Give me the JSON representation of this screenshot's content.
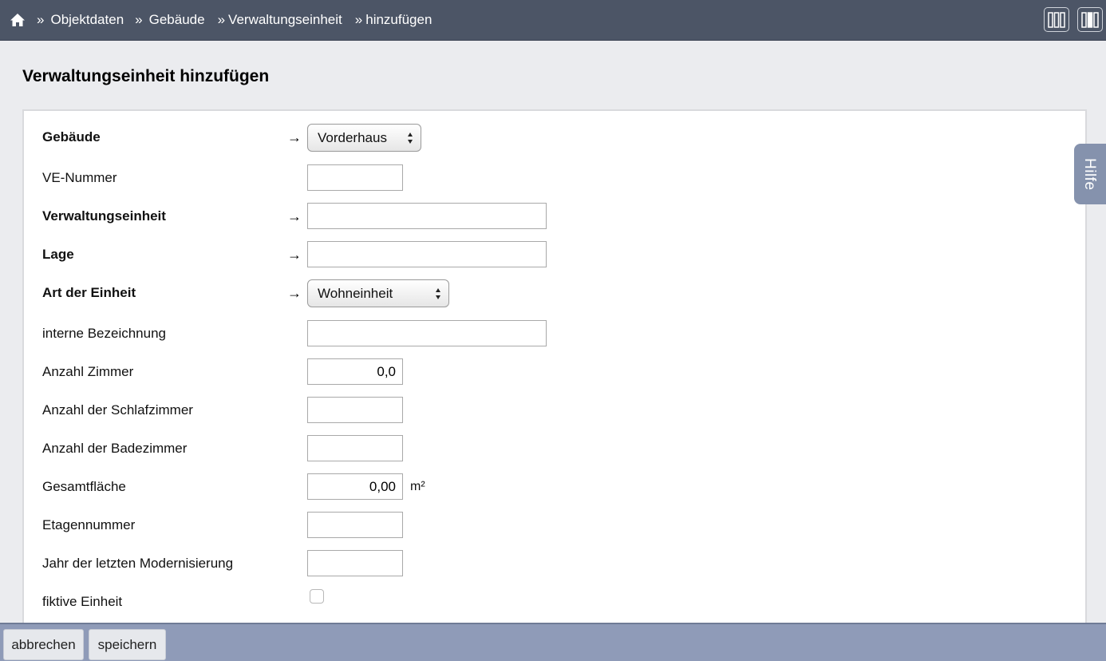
{
  "breadcrumb": {
    "separator": "»",
    "items": [
      "Objektdaten",
      "Gebäude",
      "Verwaltungseinheit",
      "hinzufügen"
    ]
  },
  "page_title": "Verwaltungseinheit hinzufügen",
  "help_label": "Hilfe",
  "form": {
    "arrow": "→",
    "gebaeude": {
      "label": "Gebäude",
      "value": "Vorderhaus"
    },
    "ve_nummer": {
      "label": "VE-Nummer",
      "value": ""
    },
    "verwaltungseinheit": {
      "label": "Verwaltungseinheit",
      "value": ""
    },
    "lage": {
      "label": "Lage",
      "value": ""
    },
    "art": {
      "label": "Art der Einheit",
      "value": "Wohneinheit"
    },
    "interne_bezeichnung": {
      "label": "interne Bezeichnung",
      "value": ""
    },
    "anzahl_zimmer": {
      "label": "Anzahl Zimmer",
      "value": "0,0"
    },
    "schlafzimmer": {
      "label": "Anzahl der Schlafzimmer",
      "value": ""
    },
    "badezimmer": {
      "label": "Anzahl der Badezimmer",
      "value": ""
    },
    "gesamtflaeche": {
      "label": "Gesamtfläche",
      "value": "0,00",
      "unit": "m²"
    },
    "etagennummer": {
      "label": "Etagennummer",
      "value": ""
    },
    "modernisierung": {
      "label": "Jahr der letzten Modernisierung",
      "value": ""
    },
    "fiktiv": {
      "label": "fiktive Einheit",
      "checked": false
    }
  },
  "footer": {
    "cancel_label": "abbrechen",
    "save_label": "speichern"
  },
  "colors": {
    "topbar": "#4c5566",
    "footer": "#8f9bb8",
    "help_tab": "#8592ad",
    "background": "#ebecef"
  }
}
